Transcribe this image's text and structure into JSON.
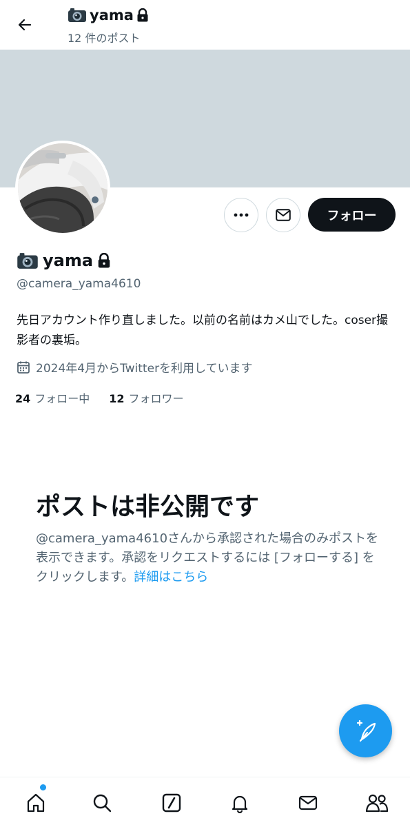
{
  "header": {
    "title": "yama",
    "post_count": "12 件のポスト"
  },
  "profile": {
    "name": "yama",
    "handle": "@camera_yama4610",
    "bio": "先日アカウント作り直しました。以前の名前はカメ山でした。coser撮影者の裏垢。",
    "joined": "2024年4月からTwitterを利用しています",
    "following_count": "24",
    "following_label": "フォロー中",
    "followers_count": "12",
    "followers_label": "フォロワー"
  },
  "actions": {
    "follow_label": "フォロー"
  },
  "private_notice": {
    "title": "ポストは非公開です",
    "body": "@camera_yama4610さんから承認された場合のみポストを表示できます。承認をリクエストするには [フォローする] をクリックします。",
    "link": "詳細はこちら"
  },
  "icons": {
    "back": "arrow-left-icon",
    "camera": "camera-icon",
    "lock": "lock-icon",
    "more": "more-icon",
    "message": "envelope-icon",
    "calendar": "calendar-icon",
    "compose": "compose-icon",
    "nav": [
      "home-icon",
      "search-icon",
      "grok-icon",
      "notifications-icon",
      "messages-icon",
      "communities-icon"
    ]
  },
  "colors": {
    "accent": "#1d9bf0",
    "banner": "#cfd9de",
    "text": "#0f1419",
    "secondary": "#536471"
  }
}
